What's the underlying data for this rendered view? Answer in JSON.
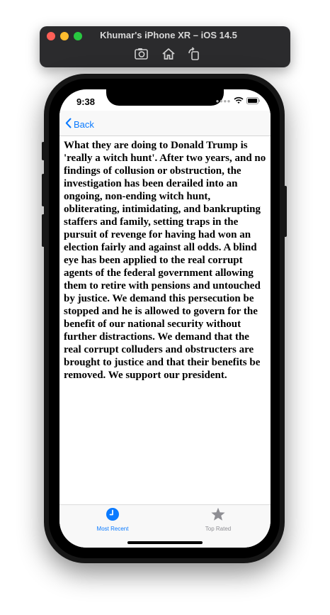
{
  "simulator": {
    "title": "Khumar's iPhone XR – iOS 14.5",
    "toolbar": [
      "screenshot-icon",
      "home-icon",
      "rotate-icon"
    ]
  },
  "status_bar": {
    "time": "9:38",
    "indicators": [
      "cellular-dots-icon",
      "wifi-icon",
      "battery-icon"
    ]
  },
  "nav": {
    "back_label": "Back"
  },
  "content": {
    "body": "What they are doing to Donald Trump is 'really a witch hunt'. After two years, and no findings of collusion or obstruction, the investigation has been derailed into an ongoing, non-ending witch hunt, obliterating, intimidating, and bankrupting staffers and family, setting traps in the pursuit of revenge for having had won an election fairly and against all odds. A blind eye has been applied to the real corrupt agents of the federal government allowing them to retire with pensions and untouched by justice. We demand this persecution be stopped and he is allowed to govern for the benefit of our national security without further distractions. We demand that the real corrupt colluders and obstructers are brought to justice and that their benefits be removed. We support our president."
  },
  "tabs": [
    {
      "label": "Most Recent",
      "icon": "clock-icon",
      "selected": true,
      "color": "#0a7aff"
    },
    {
      "label": "Top Rated",
      "icon": "star-icon",
      "selected": false,
      "color": "#8e8e93"
    }
  ],
  "colors": {
    "accent": "#0a7aff",
    "inactive": "#8e8e93"
  }
}
